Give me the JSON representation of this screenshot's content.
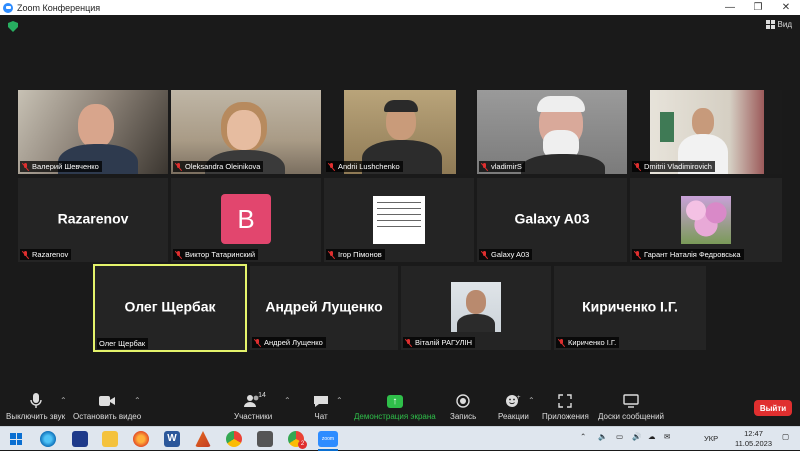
{
  "window": {
    "title": "Zoom Конференция",
    "minimize": "—",
    "maximize": "❐",
    "close": "✕"
  },
  "view_button": {
    "label": "Вид"
  },
  "tiles": [
    {
      "name": "Валерий Шевченко"
    },
    {
      "name": "Oleksandra Oleinikova"
    },
    {
      "name": "Andrii Lushchenko"
    },
    {
      "name": "vladimirS"
    },
    {
      "name": "Dmitrii Vladimirovich"
    },
    {
      "name": "Razarenov",
      "center_text": "Razarenov"
    },
    {
      "name": "Виктор Татаринский",
      "avatar_letter": "B"
    },
    {
      "name": "Ігор Пімонов"
    },
    {
      "name": "Galaxy A03",
      "center_text": "Galaxy A03"
    },
    {
      "name": "Гарант Наталія Федровська"
    },
    {
      "name": "Олег Щербак",
      "center_text": "Олег Щербак"
    },
    {
      "name": "Андрей Лущенко",
      "center_text": "Андрей Лущенко"
    },
    {
      "name": "Віталій РАГУЛІН"
    },
    {
      "name": "Кириченко І.Г.",
      "center_text": "Кириченко І.Г."
    }
  ],
  "toolbar": {
    "mute": "Выключить звук",
    "video": "Остановить видео",
    "participants": "Участники",
    "participants_count": "14",
    "chat": "Чат",
    "share": "Демонстрация экрана",
    "record": "Запись",
    "reactions": "Реакции",
    "apps": "Приложения",
    "whiteboards": "Доски сообщений",
    "leave": "Выйти"
  },
  "taskbar": {
    "language": "УКР",
    "time": "12:47",
    "date": "11.05.2023",
    "chrome_badge": "2"
  },
  "colors": {
    "accent_green": "#2fbf4a",
    "leave_red": "#e02f2f",
    "active_speaker": "#e4f36b",
    "zoom_blue": "#2d8cff"
  }
}
